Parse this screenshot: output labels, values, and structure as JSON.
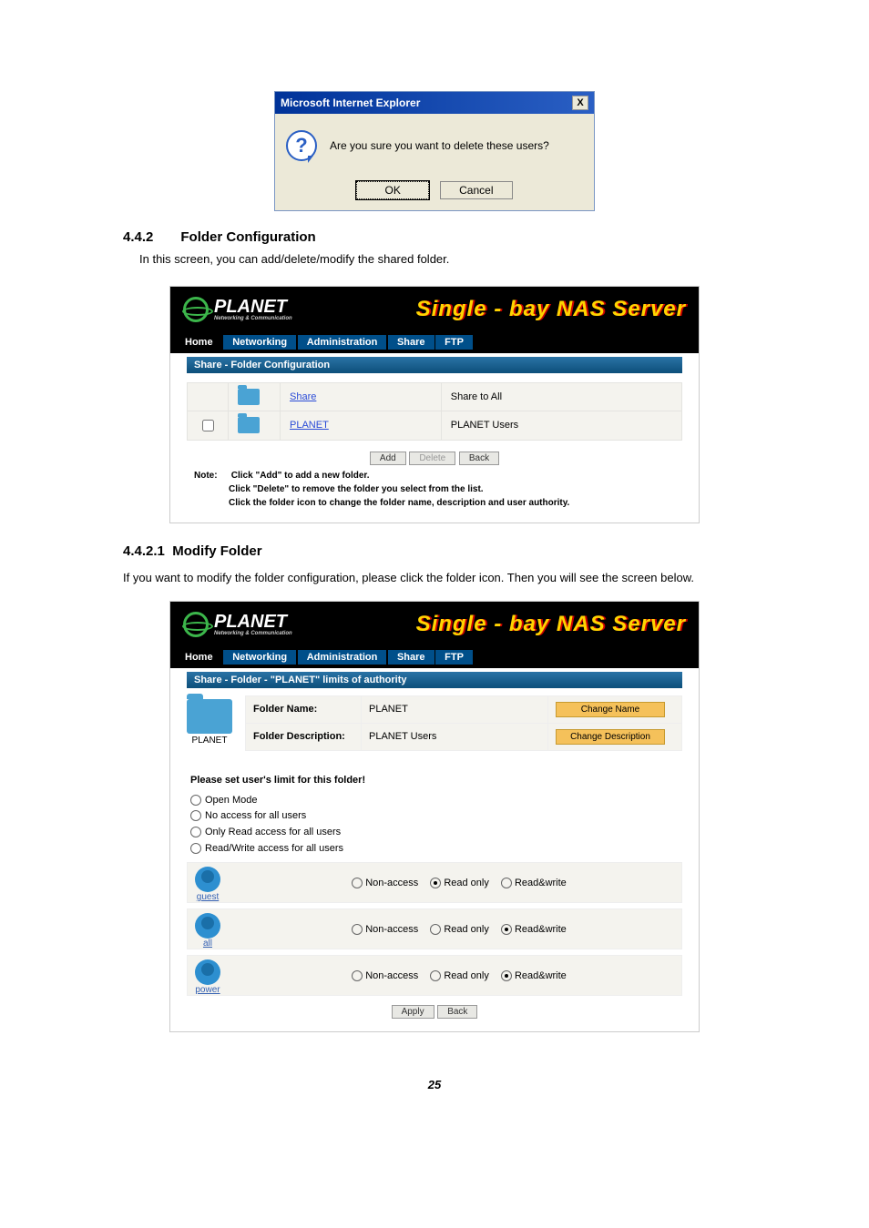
{
  "dialog": {
    "title": "Microsoft Internet Explorer",
    "close": "X",
    "message": "Are you sure you want to delete these users?",
    "ok": "OK",
    "cancel": "Cancel"
  },
  "sec442": {
    "num": "4.4.2",
    "title": "Folder Configuration",
    "intro": "In this screen, you can add/delete/modify the shared folder."
  },
  "nas": {
    "logo": "PLANET",
    "logo_sub": "Networking & Communication",
    "title": "Single - bay NAS Server",
    "nav": {
      "home": "Home",
      "networking": "Networking",
      "admin": "Administration",
      "share": "Share",
      "ftp": "FTP"
    }
  },
  "folder_list": {
    "section": "Share - Folder Configuration",
    "rows": [
      {
        "name": "Share",
        "desc": "Share to All",
        "checkbox": false
      },
      {
        "name": "PLANET",
        "desc": "PLANET Users",
        "checkbox": true
      }
    ],
    "btn_add": "Add",
    "btn_delete": "Delete",
    "btn_back": "Back",
    "note_label": "Note:",
    "note1": "Click \"Add\" to add a new folder.",
    "note2": "Click \"Delete\" to remove the folder you select from the list.",
    "note3": "Click the folder icon to change the folder name, description and user authority."
  },
  "sec4421": {
    "num": "4.4.2.1",
    "title": "Modify Folder",
    "intro": "If you want to modify the folder configuration, please click the folder icon. Then you will see the screen below."
  },
  "folder_detail": {
    "section": "Share - Folder - \"PLANET\" limits of authority",
    "folder_label": "PLANET",
    "name_lbl": "Folder Name:",
    "name_val": "PLANET",
    "desc_lbl": "Folder Description:",
    "desc_val": "PLANET Users",
    "btn_name": "Change Name",
    "btn_desc": "Change Description",
    "limit_title": "Please set user's limit for this folder!",
    "modes": {
      "open": "Open Mode",
      "noacc": "No access for all users",
      "readonly": "Only Read access for all users",
      "rw": "Read/Write access for all users"
    },
    "perm_labels": {
      "non": "Non-access",
      "ro": "Read only",
      "rw": "Read&write"
    },
    "users": [
      {
        "name": "guest",
        "sel": "ro"
      },
      {
        "name": "all",
        "sel": "rw"
      },
      {
        "name": "power",
        "sel": "rw"
      }
    ],
    "btn_apply": "Apply",
    "btn_back": "Back"
  },
  "page_num": "25"
}
